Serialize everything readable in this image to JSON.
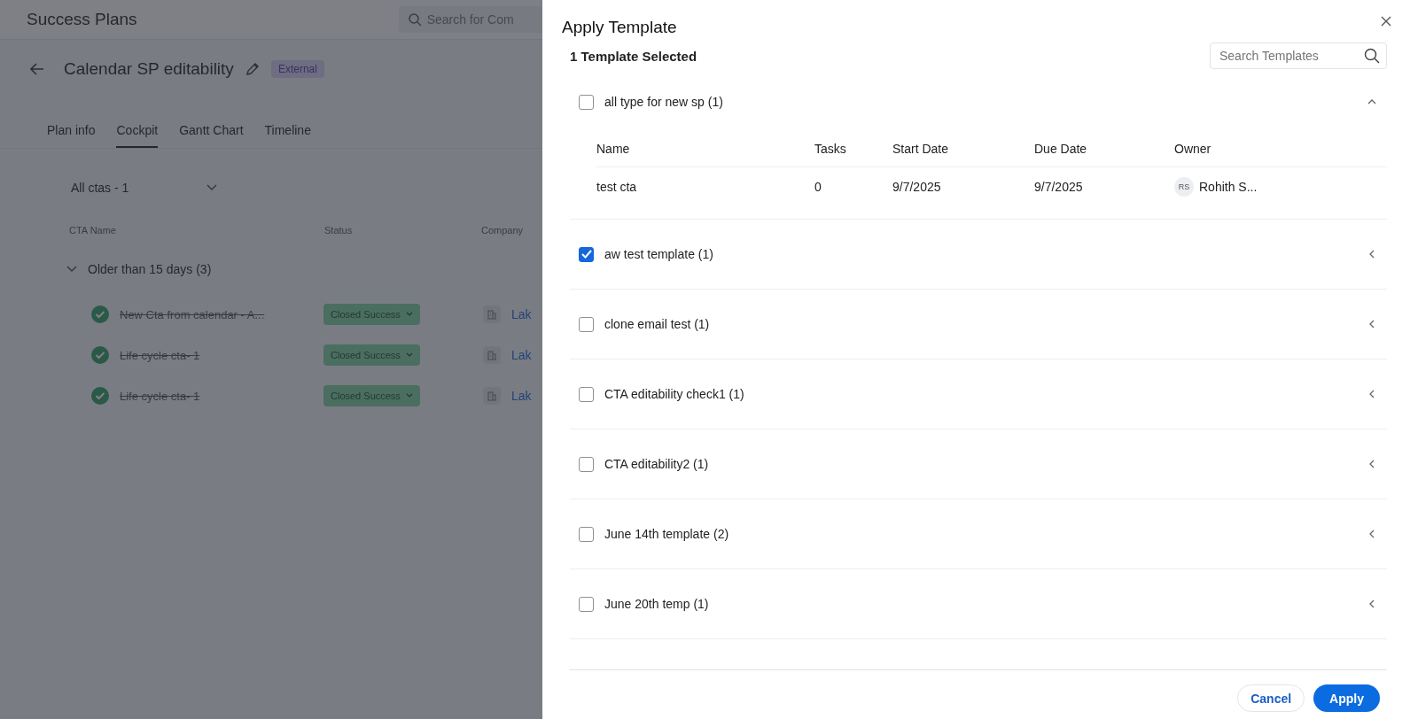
{
  "page": {
    "title": "Success Plans",
    "search": {
      "placeholder": "Search for Com"
    },
    "plan": {
      "title": "Calendar SP editability",
      "badge": "External"
    },
    "tabs": [
      {
        "label": "Plan info",
        "selected": false
      },
      {
        "label": "Cockpit",
        "selected": true
      },
      {
        "label": "Gantt Chart",
        "selected": false
      },
      {
        "label": "Timeline",
        "selected": false
      }
    ],
    "filter": "All ctas - 1",
    "columns": [
      "CTA Name",
      "Status",
      "Company"
    ],
    "group": {
      "label": "Older than 15 days (3)",
      "expanded": true,
      "rows": [
        {
          "name": "New Cta from calendar - A...",
          "done": true,
          "status": "Closed Success",
          "company": "Lak"
        },
        {
          "name": "Life cycle cta- 1",
          "done": true,
          "status": "Closed Success",
          "company": "Lak"
        },
        {
          "name": "Life cycle cta- 1",
          "done": true,
          "status": "Closed Success",
          "company": "Lak"
        }
      ]
    }
  },
  "drawer": {
    "title": "Apply Template",
    "selected_count": "1 Template Selected",
    "search": {
      "placeholder": "Search Templates"
    },
    "columns": [
      "Name",
      "Tasks",
      "Start Date",
      "Due Date",
      "Owner"
    ],
    "templates": [
      {
        "name": "all type for new sp (1)",
        "checked": false,
        "expanded": true,
        "rows": [
          {
            "name": "test cta",
            "tasks": "0",
            "start": "9/7/2025",
            "due": "9/7/2025",
            "initials": "RS",
            "owner": "Rohith S..."
          }
        ]
      },
      {
        "name": "aw test template (1)",
        "checked": true,
        "expanded": false
      },
      {
        "name": "clone email test (1)",
        "checked": false,
        "expanded": false
      },
      {
        "name": "CTA editability check1 (1)",
        "checked": false,
        "expanded": false
      },
      {
        "name": "CTA editability2 (1)",
        "checked": false,
        "expanded": false
      },
      {
        "name": "June 14th template (2)",
        "checked": false,
        "expanded": false
      },
      {
        "name": "June 20th temp (1)",
        "checked": false,
        "expanded": false
      }
    ],
    "buttons": {
      "cancel": "Cancel",
      "apply": "Apply"
    }
  }
}
